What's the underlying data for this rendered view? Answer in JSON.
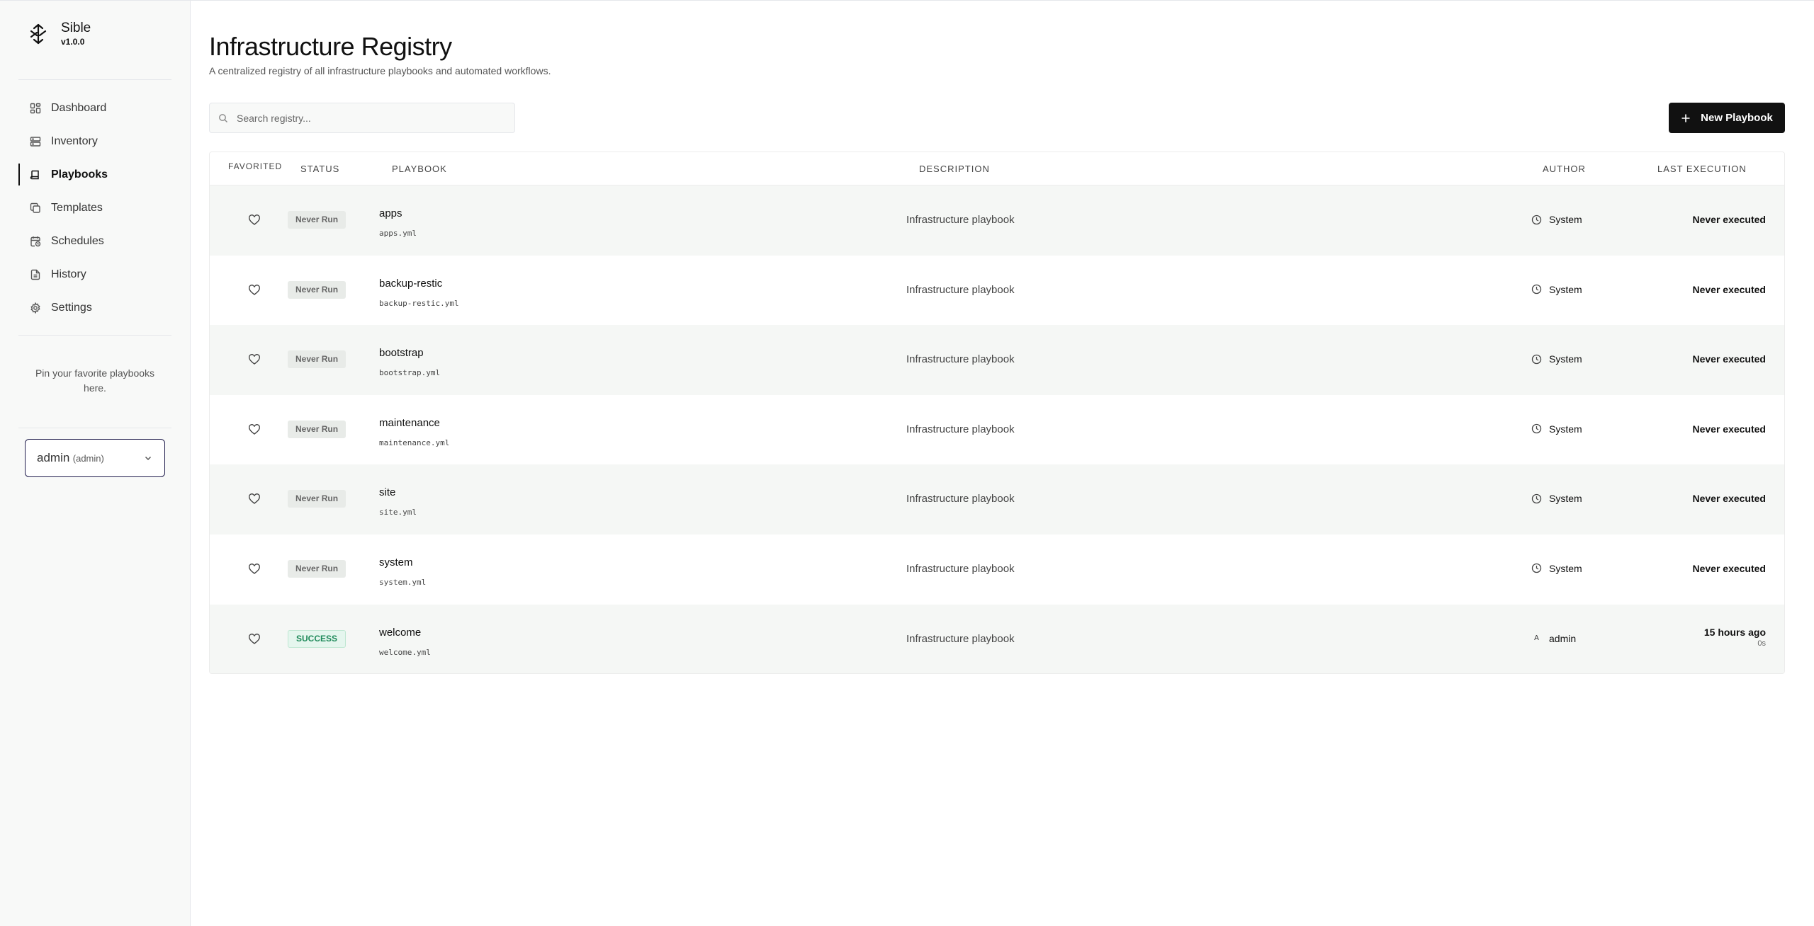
{
  "brand": {
    "name": "Sible",
    "version": "v1.0.0",
    "logo_icon": "sible-logo-icon"
  },
  "nav": [
    {
      "label": "Dashboard",
      "icon": "grid-icon",
      "active": false
    },
    {
      "label": "Inventory",
      "icon": "server-icon",
      "active": false
    },
    {
      "label": "Playbooks",
      "icon": "book-icon",
      "active": true
    },
    {
      "label": "Templates",
      "icon": "copy-icon",
      "active": false
    },
    {
      "label": "Schedules",
      "icon": "calendar-clock-icon",
      "active": false
    },
    {
      "label": "History",
      "icon": "file-text-icon",
      "active": false
    },
    {
      "label": "Settings",
      "icon": "gear-icon",
      "active": false
    }
  ],
  "sidebar": {
    "pin_text": "Pin your favorite playbooks here.",
    "user": {
      "name": "admin",
      "role": "(admin)"
    }
  },
  "page": {
    "title": "Infrastructure Registry",
    "subtitle": "A centralized registry of all infrastructure playbooks and automated workflows."
  },
  "search": {
    "placeholder": "Search registry...",
    "value": ""
  },
  "new_button": {
    "label": "New Playbook"
  },
  "table": {
    "headers": {
      "favorited": "Favorited",
      "status": "Status",
      "playbook": "Playbook",
      "description": "Description",
      "author": "Author",
      "last_execution": "Last Execution"
    },
    "rows": [
      {
        "status": "Never Run",
        "status_type": "never",
        "name": "apps",
        "file": "apps.yml",
        "description": "Infrastructure playbook",
        "author": "System",
        "author_type": "system",
        "last": "Never executed",
        "duration": ""
      },
      {
        "status": "Never Run",
        "status_type": "never",
        "name": "backup-restic",
        "file": "backup-restic.yml",
        "description": "Infrastructure playbook",
        "author": "System",
        "author_type": "system",
        "last": "Never executed",
        "duration": ""
      },
      {
        "status": "Never Run",
        "status_type": "never",
        "name": "bootstrap",
        "file": "bootstrap.yml",
        "description": "Infrastructure playbook",
        "author": "System",
        "author_type": "system",
        "last": "Never executed",
        "duration": ""
      },
      {
        "status": "Never Run",
        "status_type": "never",
        "name": "maintenance",
        "file": "maintenance.yml",
        "description": "Infrastructure playbook",
        "author": "System",
        "author_type": "system",
        "last": "Never executed",
        "duration": ""
      },
      {
        "status": "Never Run",
        "status_type": "never",
        "name": "site",
        "file": "site.yml",
        "description": "Infrastructure playbook",
        "author": "System",
        "author_type": "system",
        "last": "Never executed",
        "duration": ""
      },
      {
        "status": "Never Run",
        "status_type": "never",
        "name": "system",
        "file": "system.yml",
        "description": "Infrastructure playbook",
        "author": "System",
        "author_type": "system",
        "last": "Never executed",
        "duration": ""
      },
      {
        "status": "SUCCESS",
        "status_type": "success",
        "name": "welcome",
        "file": "welcome.yml",
        "description": "Infrastructure playbook",
        "author": "admin",
        "author_type": "user",
        "author_initial": "A",
        "last": "15 hours ago",
        "duration": "0s"
      }
    ]
  },
  "colors": {
    "primary": "#111111",
    "success": "#1f8a5a",
    "sidebar_bg": "#f8f9f8",
    "row_alt": "#f5f7f5"
  }
}
